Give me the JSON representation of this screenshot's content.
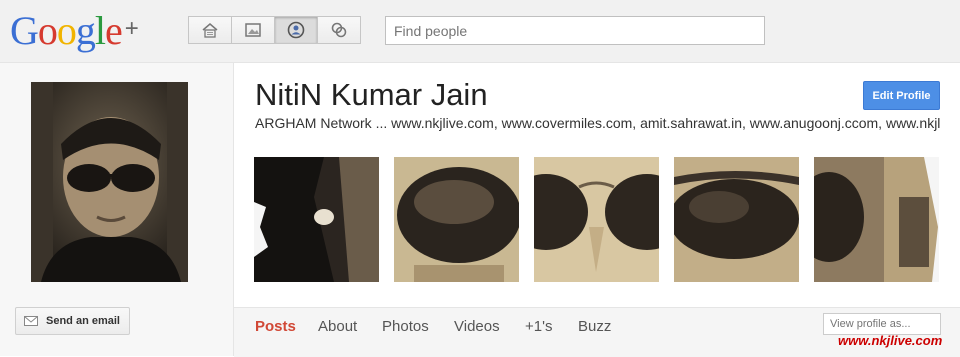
{
  "header": {
    "logo": {
      "letters": [
        "G",
        "o",
        "o",
        "g",
        "l",
        "e"
      ],
      "plus": "+"
    },
    "nav": [
      {
        "name": "home-icon",
        "active": false
      },
      {
        "name": "photos-icon",
        "active": false
      },
      {
        "name": "profile-icon",
        "active": true
      },
      {
        "name": "circles-icon",
        "active": false
      }
    ],
    "search_placeholder": "Find people"
  },
  "sidebar": {
    "send_email_label": "Send an email"
  },
  "profile": {
    "name": "NitiN Kumar Jain",
    "edit_label": "Edit Profile",
    "tagline": "ARGHAM Network ... www.nkjlive.com, www.covermiles.com, amit.sahrawat.in, www.anugoonj.ccom, www.nkjlive.com"
  },
  "tabs": [
    "Posts",
    "About",
    "Photos",
    "Videos",
    "+1's",
    "Buzz"
  ],
  "active_tab": "Posts",
  "view_as_placeholder": "View profile as...",
  "watermark": "www.nkjlive.com",
  "colors": {
    "accent_blue": "#4d8fe6",
    "active_tab_red": "#d14836",
    "watermark_red": "#cc0000"
  }
}
